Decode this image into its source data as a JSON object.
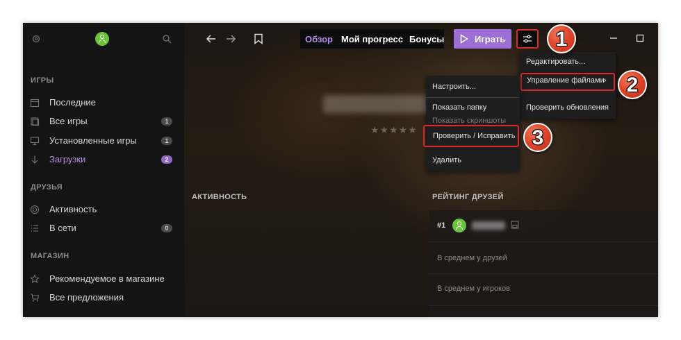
{
  "sidebar": {
    "sections": {
      "games": "ИГРЫ",
      "friends": "ДРУЗЬЯ",
      "store": "МАГАЗИН"
    },
    "items": [
      {
        "label": "Последние",
        "badge": null
      },
      {
        "label": "Все игры",
        "badge": "1"
      },
      {
        "label": "Установленные игры",
        "badge": "1"
      },
      {
        "label": "Загрузки",
        "badge": "2"
      },
      {
        "label": "Активность",
        "badge": null
      },
      {
        "label": "В сети",
        "badge": "0"
      },
      {
        "label": "Рекомендуемое в магазине",
        "badge": null
      },
      {
        "label": "Все предложения",
        "badge": null
      }
    ]
  },
  "header": {
    "tabs": [
      "Обзор",
      "Мой прогресс",
      "Бонусы"
    ],
    "active_tab": "Обзор",
    "play_label": "Играть"
  },
  "main": {
    "stars": "★★★★★",
    "activity_heading": "АКТИВНОСТЬ",
    "friends_rating_heading": "РЕЙТИНГ ДРУЗЕЙ",
    "rank": "#1",
    "avg_friends": "В среднем у друзей",
    "avg_players": "В среднем у игроков"
  },
  "settings_menu": {
    "items": [
      "Редактировать...",
      "Управление файлами",
      "Проверить обновления"
    ]
  },
  "file_menu": {
    "items": [
      "Настроить...",
      "Показать папку",
      "Показать скриншоты",
      "Проверить / Исправить",
      "Удалить"
    ]
  },
  "callouts": [
    "1",
    "2",
    "3"
  ],
  "colors": {
    "accent": "#9b6fd6",
    "accent_text": "#b58ae6",
    "highlight": "#d92b2b",
    "online": "#6ac53a"
  }
}
